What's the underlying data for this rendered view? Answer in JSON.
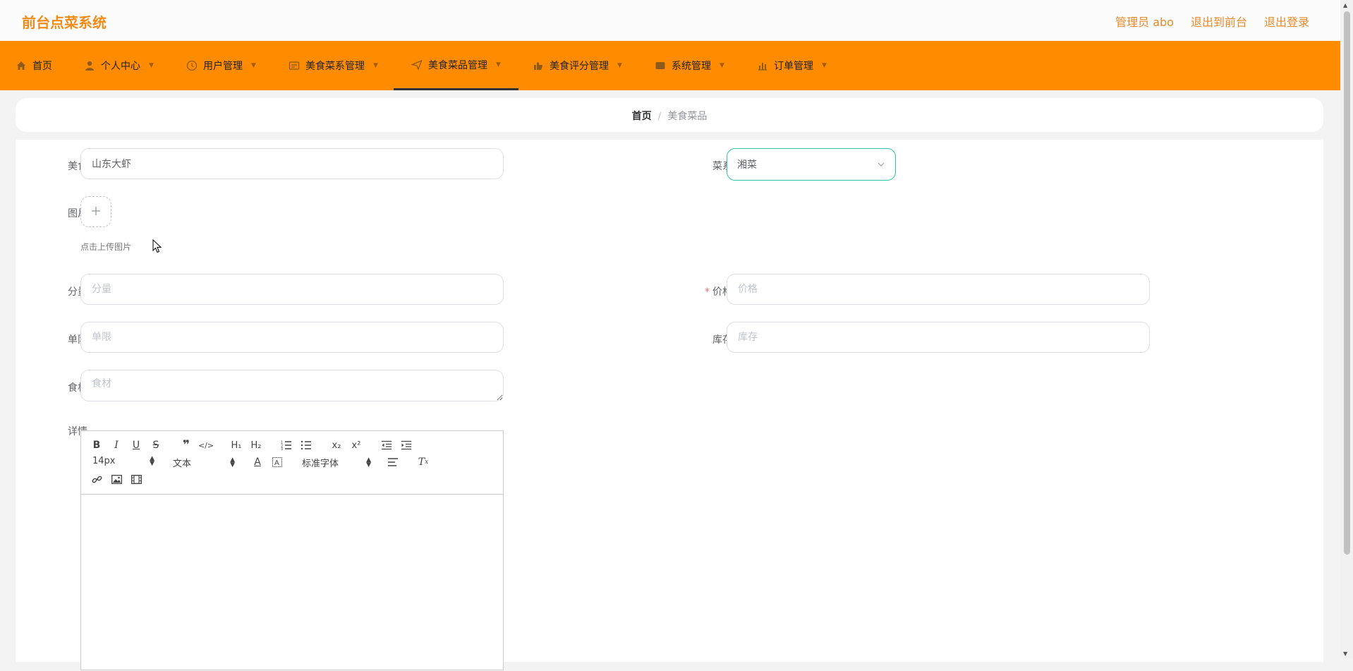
{
  "app": {
    "brand": "前台点菜系统",
    "top_links": [
      "管理员 abo",
      "退出到前台",
      "退出登录"
    ]
  },
  "nav": [
    {
      "label": "首页",
      "icon": "home-icon",
      "caret": false
    },
    {
      "label": "个人中心",
      "icon": "user-icon",
      "caret": true
    },
    {
      "label": "用户管理",
      "icon": "users-icon",
      "caret": true
    },
    {
      "label": "美食菜系管理",
      "icon": "category-icon",
      "caret": true
    },
    {
      "label": "美食菜品管理",
      "icon": "send-icon",
      "caret": true,
      "active": true
    },
    {
      "label": "美食评分管理",
      "icon": "rating-icon",
      "caret": true
    },
    {
      "label": "系统管理",
      "icon": "system-icon",
      "caret": true
    },
    {
      "label": "订单管理",
      "icon": "chart-icon",
      "caret": true
    }
  ],
  "breadcrumb": {
    "home": "首页",
    "separator": "/",
    "current": "美食菜品"
  },
  "form": {
    "food_label": "美食",
    "food_value": "山东大虾",
    "cuisine_label": "菜系",
    "cuisine_value": "湘菜",
    "image_label": "图片",
    "image_tip": "点击上传图片",
    "portion_label": "分量",
    "portion_placeholder": "分量",
    "price_label": "价格",
    "price_required": "*",
    "price_placeholder": "价格",
    "limit_label": "单限",
    "limit_placeholder": "单限",
    "stock_label": "库存",
    "stock_placeholder": "库存",
    "ingredients_label": "食材",
    "ingredients_placeholder": "食材",
    "detail_label": "详情"
  },
  "editor": {
    "font_size": "14px",
    "block_format": "文本",
    "font_family": "标准字体"
  },
  "colors": {
    "brand": "#f08c19",
    "nav_bg": "#ff8c00",
    "select_border": "#2ec4a5"
  }
}
